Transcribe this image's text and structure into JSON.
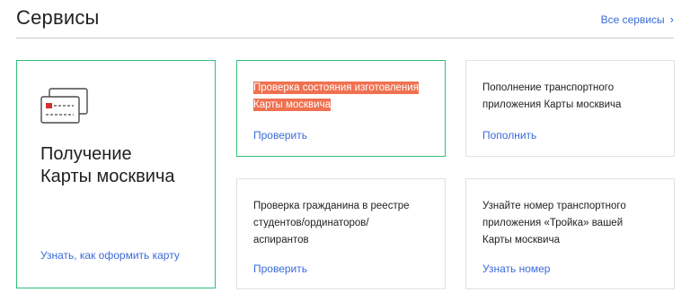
{
  "header": {
    "title": "Сервисы",
    "all_services_label": "Все сервисы",
    "chevron": "›"
  },
  "colors": {
    "accent_link": "#3a6bd8",
    "green_border": "#2fbf7a",
    "highlight": "#ef7150",
    "card_icon_red": "#d3312a"
  },
  "cards": {
    "main": {
      "icon": "card-stack-icon",
      "title_line1": "Получение",
      "title_line2": "Карты москвича",
      "link": "Узнать, как оформить карту"
    },
    "status": {
      "text_line1": "Проверка состояния изготовления",
      "text_line2": "Карты москвича",
      "link": "Проверить"
    },
    "topup": {
      "text_line1": "Пополнение транспортного",
      "text_line2": "приложения Карты москвича",
      "link": "Пополнить"
    },
    "registry": {
      "text_line1": "Проверка гражданина в реестре",
      "text_line2": "студентов/ординаторов/",
      "text_line3": "аспирантов",
      "link": "Проверить"
    },
    "troika": {
      "text_line1": "Узнайте номер транспортного",
      "text_line2": "приложения «Тройка» вашей",
      "text_line3": "Карты москвича",
      "link": "Узнать номер"
    }
  }
}
